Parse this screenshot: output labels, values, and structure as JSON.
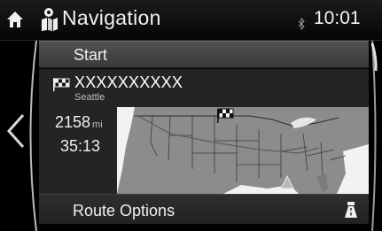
{
  "header": {
    "title": "Navigation",
    "clock": "10:01",
    "icons": [
      "home-icon",
      "navigation-icon",
      "bluetooth-icon"
    ]
  },
  "start": {
    "label": "Start"
  },
  "destination": {
    "name": "XXXXXXXXXX",
    "city": "Seattle",
    "distance_value": "2158",
    "distance_unit": "mi",
    "time": "35:13",
    "icons": [
      "checkered-flag-icon"
    ]
  },
  "route_options": {
    "label": "Route Options",
    "icon": "road-icon"
  },
  "colors": {
    "background": "#000000",
    "row_highlight": "#4a4a4a",
    "panel": "#242424",
    "map_land": "#8c8c8c",
    "map_water": "#f2f2f2"
  }
}
